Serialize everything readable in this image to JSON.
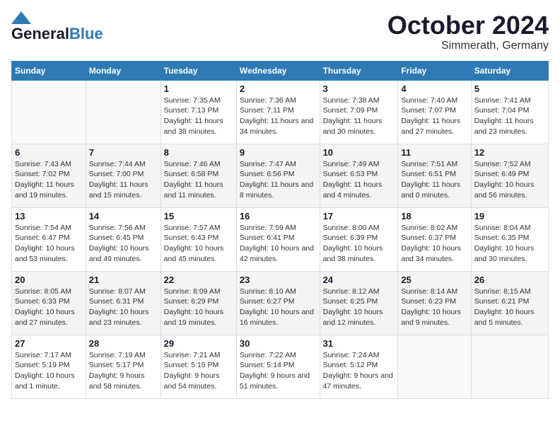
{
  "header": {
    "logo": {
      "general": "General",
      "blue": "Blue"
    },
    "title": "October 2024",
    "location": "Simmerath, Germany"
  },
  "columns": [
    "Sunday",
    "Monday",
    "Tuesday",
    "Wednesday",
    "Thursday",
    "Friday",
    "Saturday"
  ],
  "weeks": [
    [
      {
        "day": "",
        "info": ""
      },
      {
        "day": "",
        "info": ""
      },
      {
        "day": "1",
        "info": "Sunrise: 7:35 AM\nSunset: 7:13 PM\nDaylight: 11 hours and 38 minutes."
      },
      {
        "day": "2",
        "info": "Sunrise: 7:36 AM\nSunset: 7:11 PM\nDaylight: 11 hours and 34 minutes."
      },
      {
        "day": "3",
        "info": "Sunrise: 7:38 AM\nSunset: 7:09 PM\nDaylight: 11 hours and 30 minutes."
      },
      {
        "day": "4",
        "info": "Sunrise: 7:40 AM\nSunset: 7:07 PM\nDaylight: 11 hours and 27 minutes."
      },
      {
        "day": "5",
        "info": "Sunrise: 7:41 AM\nSunset: 7:04 PM\nDaylight: 11 hours and 23 minutes."
      }
    ],
    [
      {
        "day": "6",
        "info": "Sunrise: 7:43 AM\nSunset: 7:02 PM\nDaylight: 11 hours and 19 minutes."
      },
      {
        "day": "7",
        "info": "Sunrise: 7:44 AM\nSunset: 7:00 PM\nDaylight: 11 hours and 15 minutes."
      },
      {
        "day": "8",
        "info": "Sunrise: 7:46 AM\nSunset: 6:58 PM\nDaylight: 11 hours and 11 minutes."
      },
      {
        "day": "9",
        "info": "Sunrise: 7:47 AM\nSunset: 6:56 PM\nDaylight: 11 hours and 8 minutes."
      },
      {
        "day": "10",
        "info": "Sunrise: 7:49 AM\nSunset: 6:53 PM\nDaylight: 11 hours and 4 minutes."
      },
      {
        "day": "11",
        "info": "Sunrise: 7:51 AM\nSunset: 6:51 PM\nDaylight: 11 hours and 0 minutes."
      },
      {
        "day": "12",
        "info": "Sunrise: 7:52 AM\nSunset: 6:49 PM\nDaylight: 10 hours and 56 minutes."
      }
    ],
    [
      {
        "day": "13",
        "info": "Sunrise: 7:54 AM\nSunset: 6:47 PM\nDaylight: 10 hours and 53 minutes."
      },
      {
        "day": "14",
        "info": "Sunrise: 7:56 AM\nSunset: 6:45 PM\nDaylight: 10 hours and 49 minutes."
      },
      {
        "day": "15",
        "info": "Sunrise: 7:57 AM\nSunset: 6:43 PM\nDaylight: 10 hours and 45 minutes."
      },
      {
        "day": "16",
        "info": "Sunrise: 7:59 AM\nSunset: 6:41 PM\nDaylight: 10 hours and 42 minutes."
      },
      {
        "day": "17",
        "info": "Sunrise: 8:00 AM\nSunset: 6:39 PM\nDaylight: 10 hours and 38 minutes."
      },
      {
        "day": "18",
        "info": "Sunrise: 8:02 AM\nSunset: 6:37 PM\nDaylight: 10 hours and 34 minutes."
      },
      {
        "day": "19",
        "info": "Sunrise: 8:04 AM\nSunset: 6:35 PM\nDaylight: 10 hours and 30 minutes."
      }
    ],
    [
      {
        "day": "20",
        "info": "Sunrise: 8:05 AM\nSunset: 6:33 PM\nDaylight: 10 hours and 27 minutes."
      },
      {
        "day": "21",
        "info": "Sunrise: 8:07 AM\nSunset: 6:31 PM\nDaylight: 10 hours and 23 minutes."
      },
      {
        "day": "22",
        "info": "Sunrise: 8:09 AM\nSunset: 6:29 PM\nDaylight: 10 hours and 19 minutes."
      },
      {
        "day": "23",
        "info": "Sunrise: 8:10 AM\nSunset: 6:27 PM\nDaylight: 10 hours and 16 minutes."
      },
      {
        "day": "24",
        "info": "Sunrise: 8:12 AM\nSunset: 6:25 PM\nDaylight: 10 hours and 12 minutes."
      },
      {
        "day": "25",
        "info": "Sunrise: 8:14 AM\nSunset: 6:23 PM\nDaylight: 10 hours and 9 minutes."
      },
      {
        "day": "26",
        "info": "Sunrise: 8:15 AM\nSunset: 6:21 PM\nDaylight: 10 hours and 5 minutes."
      }
    ],
    [
      {
        "day": "27",
        "info": "Sunrise: 7:17 AM\nSunset: 5:19 PM\nDaylight: 10 hours and 1 minute."
      },
      {
        "day": "28",
        "info": "Sunrise: 7:19 AM\nSunset: 5:17 PM\nDaylight: 9 hours and 58 minutes."
      },
      {
        "day": "29",
        "info": "Sunrise: 7:21 AM\nSunset: 5:15 PM\nDaylight: 9 hours and 54 minutes."
      },
      {
        "day": "30",
        "info": "Sunrise: 7:22 AM\nSunset: 5:14 PM\nDaylight: 9 hours and 51 minutes."
      },
      {
        "day": "31",
        "info": "Sunrise: 7:24 AM\nSunset: 5:12 PM\nDaylight: 9 hours and 47 minutes."
      },
      {
        "day": "",
        "info": ""
      },
      {
        "day": "",
        "info": ""
      }
    ]
  ]
}
